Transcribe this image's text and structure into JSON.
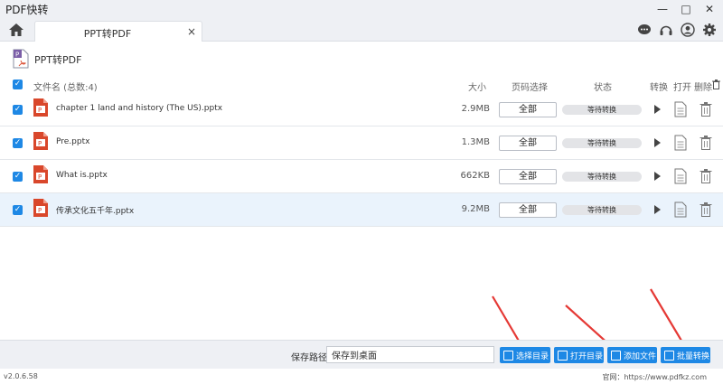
{
  "app": {
    "title": "PDF快转",
    "version": "v2.0.6.58"
  },
  "tab": {
    "label": "PPT转PDF",
    "close": "×"
  },
  "page": {
    "title": "PPT转PDF"
  },
  "list_header": {
    "filename": "文件名 (总数:4)",
    "size": "大小",
    "page_range": "页码选择",
    "status": "状态",
    "convert": "转换",
    "open": "打开",
    "delete": "删除"
  },
  "files": [
    {
      "name": "chapter 1 land and history (The US).pptx",
      "size": "2.9MB",
      "range": "全部",
      "status": "等待转换"
    },
    {
      "name": "Pre.pptx",
      "size": "1.3MB",
      "range": "全部",
      "status": "等待转换"
    },
    {
      "name": "What is.pptx",
      "size": "662KB",
      "range": "全部",
      "status": "等待转换"
    },
    {
      "name": "传承文化五千年.pptx",
      "size": "9.2MB",
      "range": "全部",
      "status": "等待转换"
    }
  ],
  "bottom": {
    "save_label": "保存路径:",
    "save_value": "保存到桌面",
    "select_dir": "选择目录",
    "open_dir": "打开目录",
    "add_file": "添加文件",
    "batch_convert": "批量转换"
  },
  "footer": {
    "site": "官网：https://www.pdfkz.com"
  },
  "colors": {
    "accent": "#1e88e5",
    "ppt": "#d9472b",
    "arrow": "#e53935"
  }
}
